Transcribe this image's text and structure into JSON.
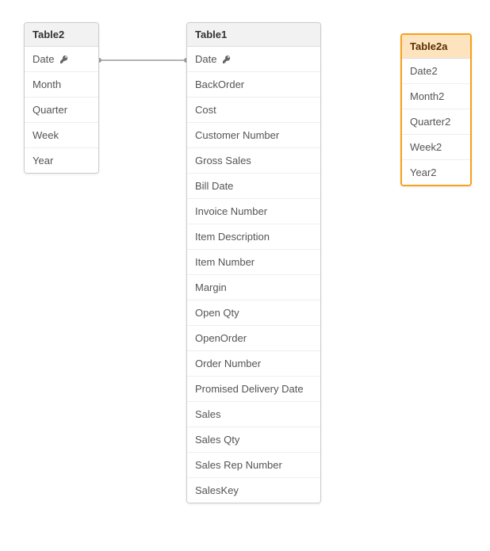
{
  "connections": [
    {
      "from": "table2.Date",
      "to": "table1.Date"
    }
  ],
  "tables": {
    "table2": {
      "title": "Table2",
      "fields": [
        {
          "name": "Date",
          "key": true
        },
        {
          "name": "Month",
          "key": false
        },
        {
          "name": "Quarter",
          "key": false
        },
        {
          "name": "Week",
          "key": false
        },
        {
          "name": "Year",
          "key": false
        }
      ]
    },
    "table1": {
      "title": "Table1",
      "fields": [
        {
          "name": "Date",
          "key": true
        },
        {
          "name": "BackOrder",
          "key": false
        },
        {
          "name": "Cost",
          "key": false
        },
        {
          "name": "Customer Number",
          "key": false
        },
        {
          "name": "Gross Sales",
          "key": false
        },
        {
          "name": "Bill Date",
          "key": false
        },
        {
          "name": "Invoice Number",
          "key": false
        },
        {
          "name": "Item Description",
          "key": false
        },
        {
          "name": "Item Number",
          "key": false
        },
        {
          "name": "Margin",
          "key": false
        },
        {
          "name": "Open Qty",
          "key": false
        },
        {
          "name": "OpenOrder",
          "key": false
        },
        {
          "name": "Order Number",
          "key": false
        },
        {
          "name": "Promised Delivery Date",
          "key": false
        },
        {
          "name": "Sales",
          "key": false
        },
        {
          "name": "Sales Qty",
          "key": false
        },
        {
          "name": "Sales Rep Number",
          "key": false
        },
        {
          "name": "SalesKey",
          "key": false
        }
      ]
    },
    "table2a": {
      "title": "Table2a",
      "highlight": true,
      "fields": [
        {
          "name": "Date2",
          "key": false
        },
        {
          "name": "Month2",
          "key": false
        },
        {
          "name": "Quarter2",
          "key": false
        },
        {
          "name": "Week2",
          "key": false
        },
        {
          "name": "Year2",
          "key": false
        }
      ]
    }
  }
}
